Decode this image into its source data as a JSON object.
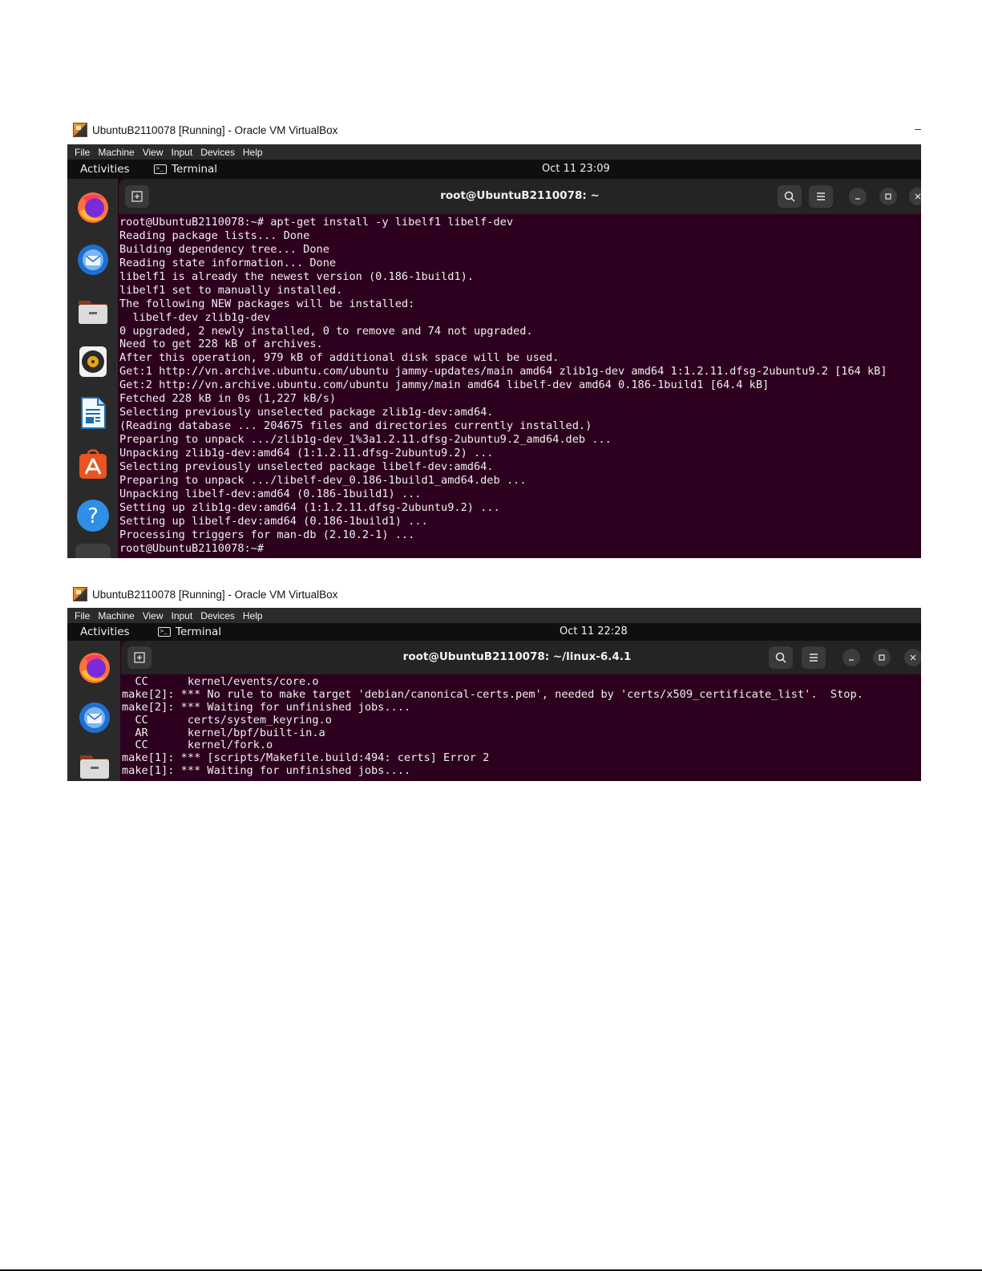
{
  "screenshot1": {
    "vbox_title": "UbuntuB2110078 [Running] - Oracle VM VirtualBox",
    "minimize_glyph": "–",
    "menu": [
      "File",
      "Machine",
      "View",
      "Input",
      "Devices",
      "Help"
    ],
    "topbar": {
      "activities": "Activities",
      "app": "Terminal",
      "clock": "Oct 11  23:09"
    },
    "dock_icons": [
      "firefox-icon",
      "thunderbird-icon",
      "files-icon",
      "rhythmbox-icon",
      "libreoffice-writer-icon",
      "app-center-icon",
      "help-icon"
    ],
    "window_title": "root@UbuntuB2110078: ~",
    "lines": [
      "root@UbuntuB2110078:~# apt-get install -y libelf1 libelf-dev",
      "Reading package lists... Done",
      "Building dependency tree... Done",
      "Reading state information... Done",
      "libelf1 is already the newest version (0.186-1build1).",
      "libelf1 set to manually installed.",
      "The following NEW packages will be installed:",
      "  libelf-dev zlib1g-dev",
      "0 upgraded, 2 newly installed, 0 to remove and 74 not upgraded.",
      "Need to get 228 kB of archives.",
      "After this operation, 979 kB of additional disk space will be used.",
      "Get:1 http://vn.archive.ubuntu.com/ubuntu jammy-updates/main amd64 zlib1g-dev amd64 1:1.2.11.dfsg-2ubuntu9.2 [164 kB]",
      "Get:2 http://vn.archive.ubuntu.com/ubuntu jammy/main amd64 libelf-dev amd64 0.186-1build1 [64.4 kB]",
      "Fetched 228 kB in 0s (1,227 kB/s)",
      "Selecting previously unselected package zlib1g-dev:amd64.",
      "(Reading database ... 204675 files and directories currently installed.)",
      "Preparing to unpack .../zlib1g-dev_1%3a1.2.11.dfsg-2ubuntu9.2_amd64.deb ...",
      "Unpacking zlib1g-dev:amd64 (1:1.2.11.dfsg-2ubuntu9.2) ...",
      "Selecting previously unselected package libelf-dev:amd64.",
      "Preparing to unpack .../libelf-dev_0.186-1build1_amd64.deb ...",
      "Unpacking libelf-dev:amd64 (0.186-1build1) ...",
      "Setting up zlib1g-dev:amd64 (1:1.2.11.dfsg-2ubuntu9.2) ...",
      "Setting up libelf-dev:amd64 (0.186-1build1) ...",
      "Processing triggers for man-db (2.10.2-1) ...",
      "root@UbuntuB2110078:~# "
    ]
  },
  "screenshot2": {
    "vbox_title": "UbuntuB2110078 [Running] - Oracle VM VirtualBox",
    "menu": [
      "File",
      "Machine",
      "View",
      "Input",
      "Devices",
      "Help"
    ],
    "topbar": {
      "activities": "Activities",
      "app": "Terminal",
      "clock": "Oct 11  22:28"
    },
    "dock_icons": [
      "firefox-icon",
      "thunderbird-icon",
      "files-icon"
    ],
    "window_title": "root@UbuntuB2110078: ~/linux-6.4.1",
    "lines": [
      "  CC      kernel/events/core.o",
      "make[2]: *** No rule to make target 'debian/canonical-certs.pem', needed by 'certs/x509_certificate_list'.  Stop.",
      "make[2]: *** Waiting for unfinished jobs....",
      "  CC      certs/system_keyring.o",
      "  AR      kernel/bpf/built-in.a",
      "  CC      kernel/fork.o",
      "make[1]: *** [scripts/Makefile.build:494: certs] Error 2",
      "make[1]: *** Waiting for unfinished jobs...."
    ]
  },
  "colors": {
    "terminal_bg": "#2c001e",
    "terminal_fg": "#f0f0f0",
    "headerbar": "#242424",
    "dock": "#2a2a2a",
    "topbar": "#0f0f0f"
  }
}
